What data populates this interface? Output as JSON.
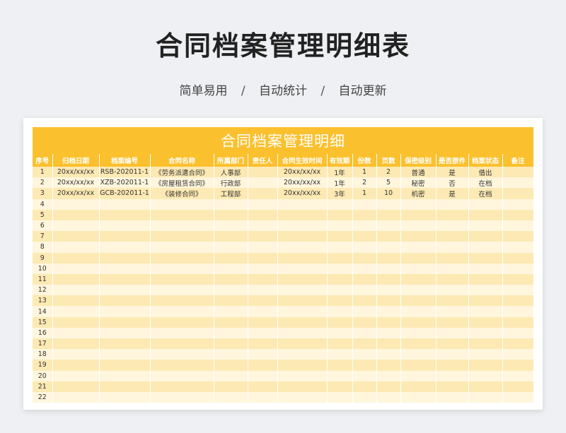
{
  "header": {
    "title": "合同档案管理明细表",
    "subtitle_parts": [
      "简单易用",
      "自动统计",
      "自动更新"
    ],
    "separator": "/"
  },
  "sheet": {
    "title": "合同档案管理明细",
    "columns": [
      "序号",
      "归档日期",
      "档案编号",
      "合同名称",
      "所属部门",
      "责任人",
      "合同生效时间",
      "有效期",
      "份数",
      "页数",
      "保密级别",
      "是否原件",
      "档案状态",
      "备注"
    ],
    "rows": [
      [
        "1",
        "20xx/xx/xx",
        "RSB-202011-1",
        "《劳务派遣合同》",
        "人事部",
        "",
        "20xx/xx/xx",
        "1年",
        "1",
        "2",
        "普通",
        "是",
        "借出",
        ""
      ],
      [
        "2",
        "20xx/xx/xx",
        "XZB-202011-1",
        "《房屋租赁合同》",
        "行政部",
        "",
        "20xx/xx/xx",
        "1年",
        "2",
        "5",
        "秘密",
        "否",
        "在档",
        ""
      ],
      [
        "3",
        "20xx/xx/xx",
        "GCB-202011-1",
        "《装修合同》",
        "工程部",
        "",
        "20xx/xx/xx",
        "3年",
        "1",
        "10",
        "机密",
        "是",
        "在档",
        ""
      ],
      [
        "4",
        "",
        "",
        "",
        "",
        "",
        "",
        "",
        "",
        "",
        "",
        "",
        "",
        ""
      ],
      [
        "5",
        "",
        "",
        "",
        "",
        "",
        "",
        "",
        "",
        "",
        "",
        "",
        "",
        ""
      ],
      [
        "6",
        "",
        "",
        "",
        "",
        "",
        "",
        "",
        "",
        "",
        "",
        "",
        "",
        ""
      ],
      [
        "7",
        "",
        "",
        "",
        "",
        "",
        "",
        "",
        "",
        "",
        "",
        "",
        "",
        ""
      ],
      [
        "8",
        "",
        "",
        "",
        "",
        "",
        "",
        "",
        "",
        "",
        "",
        "",
        "",
        ""
      ],
      [
        "9",
        "",
        "",
        "",
        "",
        "",
        "",
        "",
        "",
        "",
        "",
        "",
        "",
        ""
      ],
      [
        "10",
        "",
        "",
        "",
        "",
        "",
        "",
        "",
        "",
        "",
        "",
        "",
        "",
        ""
      ],
      [
        "11",
        "",
        "",
        "",
        "",
        "",
        "",
        "",
        "",
        "",
        "",
        "",
        "",
        ""
      ],
      [
        "12",
        "",
        "",
        "",
        "",
        "",
        "",
        "",
        "",
        "",
        "",
        "",
        "",
        ""
      ],
      [
        "13",
        "",
        "",
        "",
        "",
        "",
        "",
        "",
        "",
        "",
        "",
        "",
        "",
        ""
      ],
      [
        "14",
        "",
        "",
        "",
        "",
        "",
        "",
        "",
        "",
        "",
        "",
        "",
        "",
        ""
      ],
      [
        "15",
        "",
        "",
        "",
        "",
        "",
        "",
        "",
        "",
        "",
        "",
        "",
        "",
        ""
      ],
      [
        "16",
        "",
        "",
        "",
        "",
        "",
        "",
        "",
        "",
        "",
        "",
        "",
        "",
        ""
      ],
      [
        "17",
        "",
        "",
        "",
        "",
        "",
        "",
        "",
        "",
        "",
        "",
        "",
        "",
        ""
      ],
      [
        "18",
        "",
        "",
        "",
        "",
        "",
        "",
        "",
        "",
        "",
        "",
        "",
        "",
        ""
      ],
      [
        "19",
        "",
        "",
        "",
        "",
        "",
        "",
        "",
        "",
        "",
        "",
        "",
        "",
        ""
      ],
      [
        "20",
        "",
        "",
        "",
        "",
        "",
        "",
        "",
        "",
        "",
        "",
        "",
        "",
        ""
      ],
      [
        "21",
        "",
        "",
        "",
        "",
        "",
        "",
        "",
        "",
        "",
        "",
        "",
        "",
        ""
      ],
      [
        "22",
        "",
        "",
        "",
        "",
        "",
        "",
        "",
        "",
        "",
        "",
        "",
        "",
        ""
      ]
    ]
  },
  "colors": {
    "header_yellow": "#fbc02d",
    "row_odd": "#fde9b3",
    "row_even": "#fff6dd",
    "page_bg": "#eef0f3"
  }
}
